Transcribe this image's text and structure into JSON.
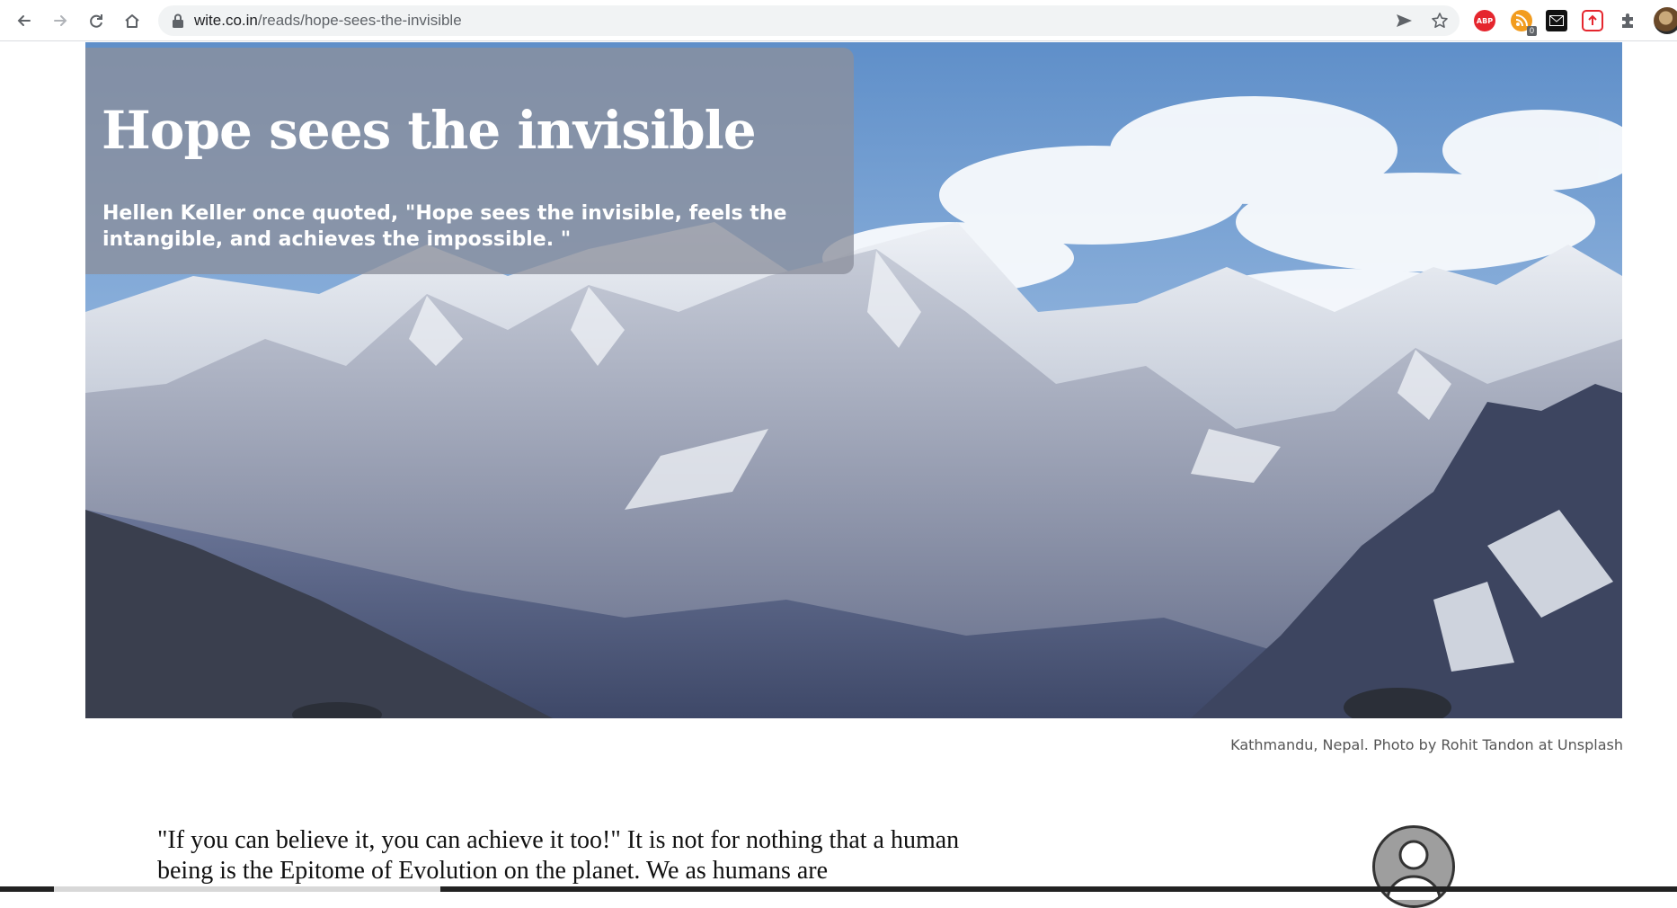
{
  "browser": {
    "url_host": "wite.co.in",
    "url_path": "/reads/hope-sees-the-invisible",
    "extensions": [
      "adblock-plus",
      "feed-reader",
      "mail-extension",
      "upload-extension",
      "extensions-puzzle"
    ],
    "feed_badge": "0",
    "abp_label": "ABP"
  },
  "hero": {
    "title": "Hope sees the invisible",
    "subtitle": "Hellen Keller once quoted, \"Hope sees the invisible, feels the intangible, and achieves the impossible. \"",
    "caption": "Kathmandu, Nepal. Photo by Rohit Tandon at Unsplash"
  },
  "article": {
    "intro": "\"If you can believe it, you can achieve it too!\" It is not for nothing that a human being is the Epitome of Evolution on the planet. We as humans are"
  },
  "colors": {
    "sky": "#6f9bcf",
    "title_card": "#8c8f9c",
    "text": "#111111"
  }
}
